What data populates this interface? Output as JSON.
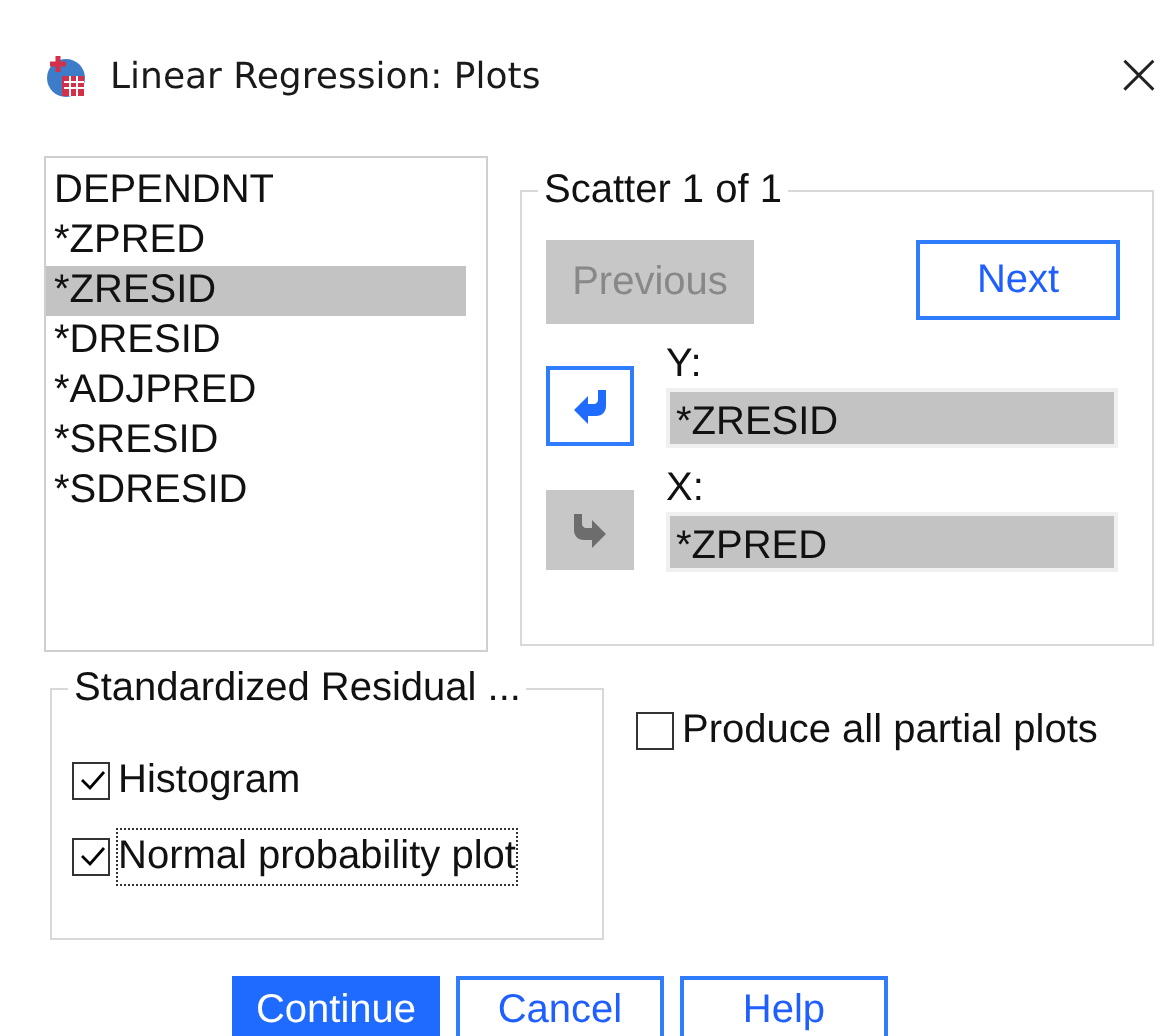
{
  "window": {
    "title": "Linear Regression: Plots",
    "close": "×"
  },
  "variables": [
    {
      "label": "DEPENDNT",
      "selected": false
    },
    {
      "label": "*ZPRED",
      "selected": false
    },
    {
      "label": "*ZRESID",
      "selected": true
    },
    {
      "label": "*DRESID",
      "selected": false
    },
    {
      "label": "*ADJPRED",
      "selected": false
    },
    {
      "label": "*SRESID",
      "selected": false
    },
    {
      "label": "*SDRESID",
      "selected": false
    }
  ],
  "scatter": {
    "title": "Scatter 1 of 1",
    "previous": {
      "label": "Previous",
      "disabled": true
    },
    "next": {
      "label": "Next",
      "disabled": false
    },
    "axes": [
      {
        "label": "Y:",
        "value": "*ZRESID",
        "kind": "move_left",
        "disabled": false
      },
      {
        "label": "X:",
        "value": "*ZPRED",
        "kind": "move_right",
        "disabled": true
      }
    ]
  },
  "residual_plots": {
    "title": "Standardized Residual ...",
    "options": [
      {
        "label": "Histogram",
        "checked": true,
        "focused": false
      },
      {
        "label": "Normal probability plot",
        "checked": true,
        "focused": true
      }
    ]
  },
  "partial_plots": {
    "label": "Produce all partial plots",
    "checked": false
  },
  "buttons": [
    {
      "label": "Continue",
      "default": true
    },
    {
      "label": "Cancel",
      "default": false
    },
    {
      "label": "Help",
      "default": false
    }
  ]
}
